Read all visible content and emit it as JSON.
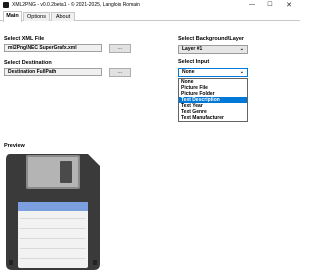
{
  "window": {
    "title": "XML2PNG - v0.0.2beta1 - © 2021-2025, Langlois Romain",
    "minimize": "—",
    "maximize": "☐",
    "close": "✕"
  },
  "tabs": [
    {
      "label": "Main"
    },
    {
      "label": "Options"
    },
    {
      "label": "About"
    }
  ],
  "xml_file": {
    "label": "Select XML File",
    "value": "ml2Png\\NEC SuperGrafx.xml",
    "browse": "..."
  },
  "destination": {
    "label": "Select Destination",
    "value": "Destination FullPath",
    "browse": "..."
  },
  "background_layer": {
    "label": "Select Background\\Layer",
    "value": "Layer #1"
  },
  "input": {
    "label": "Select Input",
    "value": "None",
    "options": [
      "None",
      "Picture File",
      "Picture Folder",
      "Text Description",
      "Text Year",
      "Text Genre",
      "Text Manufacturer"
    ],
    "highlighted": "Text Description"
  },
  "preview": {
    "label": "Preview",
    "icon": "floppy-disk-icon"
  },
  "colors": {
    "accent": "#0078d7",
    "floppy_body": "#3a3a3a",
    "floppy_label": "#7c9fe0"
  }
}
